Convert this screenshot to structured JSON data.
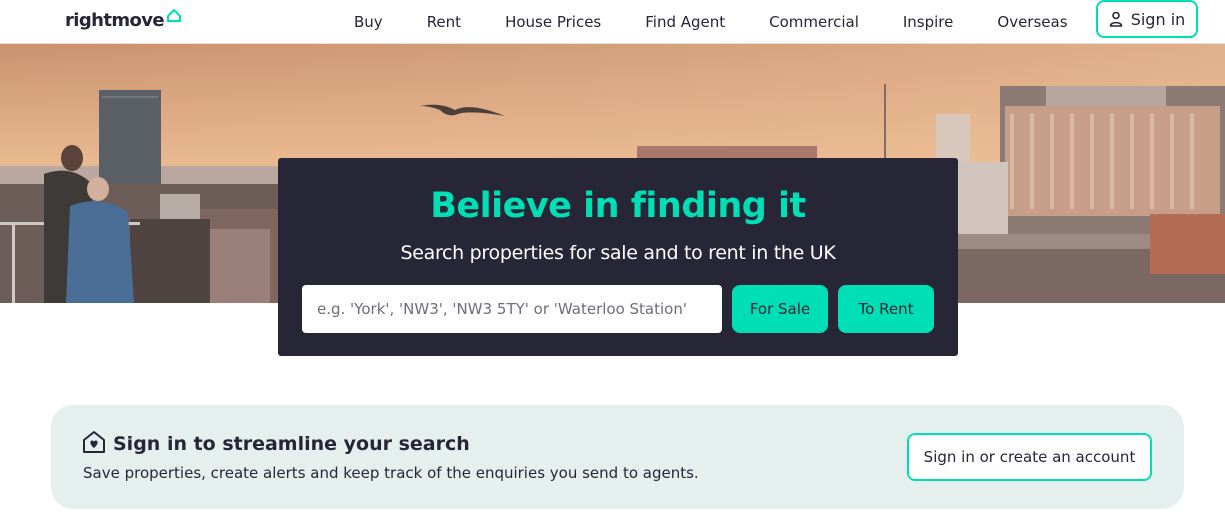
{
  "header": {
    "logo_text": "rightmove",
    "nav": [
      "Buy",
      "Rent",
      "House Prices",
      "Find Agent",
      "Commercial",
      "Inspire",
      "Overseas"
    ],
    "signin_label": "Sign in"
  },
  "hero": {
    "title": "Believe in finding it",
    "subtitle": "Search properties for sale and to rent in the UK",
    "search": {
      "placeholder": "e.g. 'York', 'NW3', 'NW3 5TY' or 'Waterloo Station'",
      "value": ""
    },
    "for_sale_label": "For Sale",
    "to_rent_label": "To Rent"
  },
  "banner": {
    "title": "Sign in to streamline your search",
    "text": "Save properties, create alerts and keep track of the enquiries you send to agents.",
    "button_label": "Sign in or create an account",
    "icon": "house-heart-icon"
  },
  "colors": {
    "accent": "#00deb6",
    "dark": "#262637",
    "banner_bg": "#e5f0ee"
  }
}
